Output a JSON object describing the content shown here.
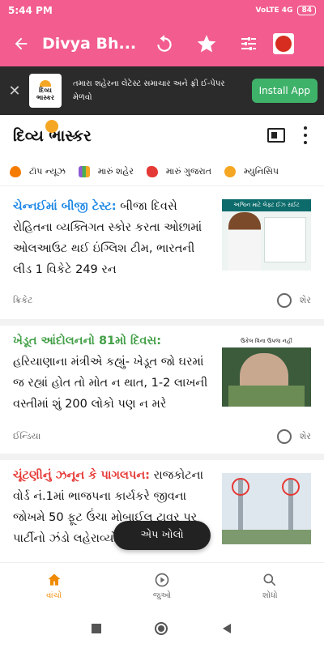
{
  "status_bar": {
    "time": "5:44 PM",
    "indicators": "VoLTE 4G",
    "battery": "84"
  },
  "app_bar": {
    "title": "Divya Bh..."
  },
  "banner": {
    "logo_text": "દિવ્ય ભાસ્કર",
    "message": "તમારા શહેરના લેટેસ્ટ સમાચાર અને ફ્રી ઈ-પેપર મેળવો",
    "install_label": "Install App"
  },
  "brand": {
    "name": "દિવ્ય ભાસ્કર"
  },
  "categories": [
    {
      "label": "ટૉપ ન્યૂઝ",
      "icon": "fire-icon",
      "color": "#f57c00"
    },
    {
      "label": "મારું શહેર",
      "icon": "city-icon",
      "color": "#8e5bd6"
    },
    {
      "label": "મારું ગુજરાત",
      "icon": "gujarat-map-icon",
      "color": "#e53935"
    },
    {
      "label": "મ્યુનિસિપ",
      "icon": "hand-icon",
      "color": "#f5a623"
    }
  ],
  "articles": [
    {
      "tag": "ચેન્નઈમાં બીજી ટેસ્ટ:",
      "tag_color": "#1e88e5",
      "headline": " બીજા દિવસે રોહિતના વ્યક્તિગત સ્કોર કરતા ઓછામાં ઓલઆઉટ થઈ ઇંગ્લિશ ટીમ, ભારતની લીડ 1 વિકેટે 249 રન",
      "category": "ક્રિકેટ",
      "share": "શેર",
      "thumb_caption": "અશ્વિન માટે લેફ્ટ ઈઝ રાઈટ"
    },
    {
      "tag": "ખેડૂત આંદોલનનો 81મો દિવસ:",
      "tag_color": "#43a047",
      "headline": " હરિયાણાના મંત્રીએ કહ્યું- ખેડૂત જો ઘરમાં જ રહ્યાં હોત તો મોત ન થાત, 1-2 લાખની વસ્તીમાં શું 200 લોકો પણ ન મરે",
      "category": "ઈન્ડિયા",
      "share": "શેર",
      "thumb_caption": "ઉકેલ વિના ઉપજ નહીં"
    },
    {
      "tag": "ચૂંટણીનું ઝનૂન કે પાગલપન:",
      "tag_color": "#e53935",
      "headline": " રાજકોટના વોર્ડ નં.1માં ભાજપના કાર્યકરે જીવના જોખમે 50 ફૂટ ઉંચા મોબાઈલ ટાવર પર પાર્ટીનો ઝંડો લહેરાવ્યો"
    }
  ],
  "fab": {
    "label": "એપ ખોલો"
  },
  "bottom_nav": [
    {
      "label": "વાંચો",
      "icon": "home-icon",
      "active": true
    },
    {
      "label": "જુઓ",
      "icon": "play-icon",
      "active": false
    },
    {
      "label": "શોધો",
      "icon": "search-icon",
      "active": false
    }
  ],
  "colors": {
    "app_bar": "#f25c8e",
    "accent": "#f08a00"
  }
}
